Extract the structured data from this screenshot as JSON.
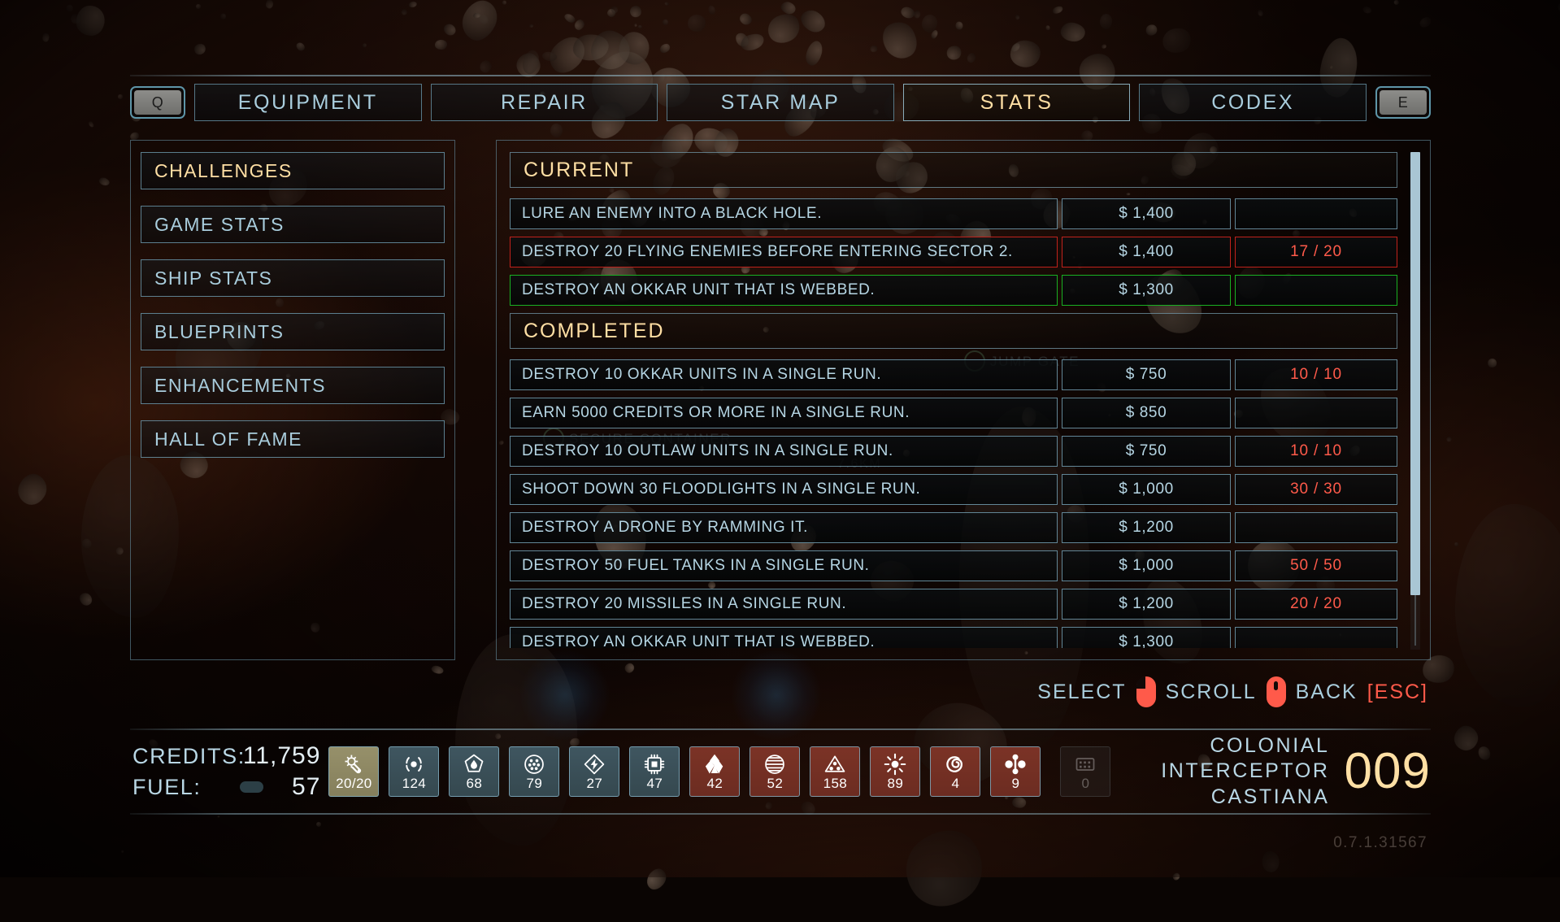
{
  "topbar": {
    "left_key": "Q",
    "right_key": "E",
    "tabs": [
      {
        "label": "EQUIPMENT",
        "active": false
      },
      {
        "label": "REPAIR",
        "active": false
      },
      {
        "label": "STAR MAP",
        "active": false
      },
      {
        "label": "STATS",
        "active": true
      },
      {
        "label": "CODEX",
        "active": false
      }
    ]
  },
  "sidebar": {
    "items": [
      {
        "label": "CHALLENGES",
        "active": true
      },
      {
        "label": "GAME STATS",
        "active": false
      },
      {
        "label": "SHIP STATS",
        "active": false
      },
      {
        "label": "BLUEPRINTS",
        "active": false
      },
      {
        "label": "ENHANCEMENTS",
        "active": false
      },
      {
        "label": "HALL OF FAME",
        "active": false
      }
    ]
  },
  "main": {
    "sections": [
      {
        "title": "CURRENT",
        "rows": [
          {
            "desc": "LURE AN ENEMY INTO A BLACK HOLE.",
            "reward": "$ 1,400",
            "progress": "",
            "state": "normal"
          },
          {
            "desc": "DESTROY 20 FLYING ENEMIES BEFORE ENTERING SECTOR 2.",
            "reward": "$ 1,400",
            "progress": "17 / 20",
            "state": "red"
          },
          {
            "desc": "DESTROY AN OKKAR UNIT THAT IS WEBBED.",
            "reward": "$ 1,300",
            "progress": "",
            "state": "green"
          }
        ]
      },
      {
        "title": "COMPLETED",
        "rows": [
          {
            "desc": "DESTROY 10 OKKAR UNITS IN A SINGLE RUN.",
            "reward": "$ 750",
            "progress": "10 / 10",
            "state": "normal"
          },
          {
            "desc": "EARN 5000 CREDITS OR MORE IN A SINGLE RUN.",
            "reward": "$ 850",
            "progress": "",
            "state": "normal"
          },
          {
            "desc": "DESTROY 10 OUTLAW UNITS IN A SINGLE RUN.",
            "reward": "$ 750",
            "progress": "10 / 10",
            "state": "normal"
          },
          {
            "desc": "SHOOT DOWN 30 FLOODLIGHTS IN A SINGLE RUN.",
            "reward": "$ 1,000",
            "progress": "30 / 30",
            "state": "normal"
          },
          {
            "desc": "DESTROY A DRONE BY RAMMING IT.",
            "reward": "$ 1,200",
            "progress": "",
            "state": "normal"
          },
          {
            "desc": "DESTROY 50 FUEL TANKS IN A SINGLE RUN.",
            "reward": "$ 1,000",
            "progress": "50 / 50",
            "state": "normal"
          },
          {
            "desc": "DESTROY 20 MISSILES IN A SINGLE RUN.",
            "reward": "$ 1,200",
            "progress": "20 / 20",
            "state": "normal"
          },
          {
            "desc": "DESTROY AN OKKAR UNIT THAT IS WEBBED.",
            "reward": "$ 1,300",
            "progress": "",
            "state": "normal"
          }
        ]
      }
    ]
  },
  "controls": {
    "select_label": "SELECT",
    "scroll_label": "SCROLL",
    "back_label": "BACK",
    "esc_label": "[ESC]"
  },
  "status": {
    "credits_label": "CREDITS:",
    "credits_value": "11,759",
    "fuel_label": "FUEL:",
    "fuel_value": "57",
    "fuel_percent": 57
  },
  "slots": [
    {
      "icon": "repair-kit-icon",
      "count": "20/20",
      "color": "gold"
    },
    {
      "icon": "targeting-icon",
      "count": "124",
      "color": "blue"
    },
    {
      "icon": "fuel-drop-icon",
      "count": "68",
      "color": "blue"
    },
    {
      "icon": "ammo-cluster-icon",
      "count": "79",
      "color": "blue"
    },
    {
      "icon": "energy-bolt-icon",
      "count": "27",
      "color": "blue"
    },
    {
      "icon": "chip-icon",
      "count": "47",
      "color": "blue"
    },
    {
      "icon": "crystal-icon",
      "count": "42",
      "color": "red"
    },
    {
      "icon": "disc-stack-icon",
      "count": "52",
      "color": "red"
    },
    {
      "icon": "hazard-triangle-icon",
      "count": "158",
      "color": "red"
    },
    {
      "icon": "starburst-icon",
      "count": "89",
      "color": "red"
    },
    {
      "icon": "spiral-icon",
      "count": "4",
      "color": "red"
    },
    {
      "icon": "molecule-icon",
      "count": "9",
      "color": "red"
    },
    {
      "icon": "keypad-icon",
      "count": "0",
      "color": "dim"
    }
  ],
  "ship": {
    "class": "COLONIAL INTERCEPTOR",
    "name": "CASTIANA",
    "number": "009"
  },
  "background_hud": [
    {
      "label": "JUMP GATE"
    },
    {
      "label": "SECURE CONTAINER"
    },
    {
      "label": "7.6KM"
    }
  ],
  "version": "0.7.1.31567",
  "colors": {
    "accent_gold": "#ffdfa4",
    "accent_blue": "#a9cddd",
    "alert_red": "#ff5a4a",
    "success_green": "#19b023",
    "fail_border": "#c0221c"
  }
}
